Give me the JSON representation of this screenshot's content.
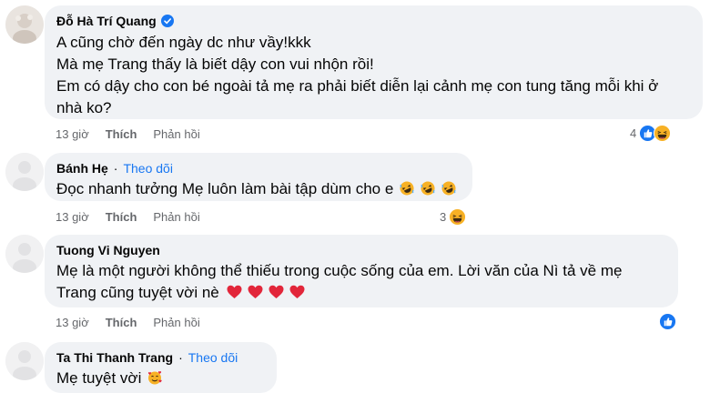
{
  "comments": [
    {
      "author": "Đỗ Hà Trí Quang",
      "verified": true,
      "lines": [
        "A cũng chờ đến ngày dc như vầy!kkk",
        "Mà mẹ Trang thấy là biết dậy con vui nhộn rồi!",
        "Em có dậy cho con bé ngoài tả mẹ ra phải biết diễn lại cảnh mẹ con tung tăng mỗi khi ở",
        "nhà ko?"
      ],
      "time": "13 giờ",
      "like": "Thích",
      "reply": "Phản hồi",
      "reaction_count": "4",
      "reactions": [
        "like",
        "haha"
      ]
    },
    {
      "author": "Bánh Hẹ",
      "sep": "·",
      "follow": "Theo dõi",
      "lines": [
        "Đọc nhanh tưởng Mẹ luôn làm bài tập dùm cho e"
      ],
      "trailing_emoji": [
        "rofl-emoji",
        "rofl-emoji",
        "rofl-emoji"
      ],
      "time": "13 giờ",
      "like": "Thích",
      "reply": "Phản hồi",
      "reaction_count": "3",
      "reactions": [
        "haha"
      ]
    },
    {
      "author": "Tuong Vi Nguyen",
      "lines": [
        "Mẹ là một người không thể thiếu trong cuộc sống của em. Lời văn của Nì tả về mẹ",
        "Trang cũng tuyệt vời nè"
      ],
      "trailing_emoji": [
        "heart-emoji",
        "heart-emoji",
        "heart-emoji",
        "heart-emoji"
      ],
      "time": "13 giờ",
      "like": "Thích",
      "reply": "Phản hồi",
      "reaction_count": "",
      "reactions": [
        "like"
      ]
    },
    {
      "author": "Ta Thi Thanh Trang",
      "sep": "·",
      "follow": "Theo dõi",
      "lines": [
        "Mẹ tuyệt vời"
      ],
      "trailing_emoji": [
        "smiling-hearts-emoji"
      ]
    }
  ],
  "colors": {
    "bubble": "#f0f2f5",
    "link": "#1877f2",
    "secondary": "#65676b",
    "like_blue": "#1877f2",
    "haha_yellow": "#f7b125"
  }
}
